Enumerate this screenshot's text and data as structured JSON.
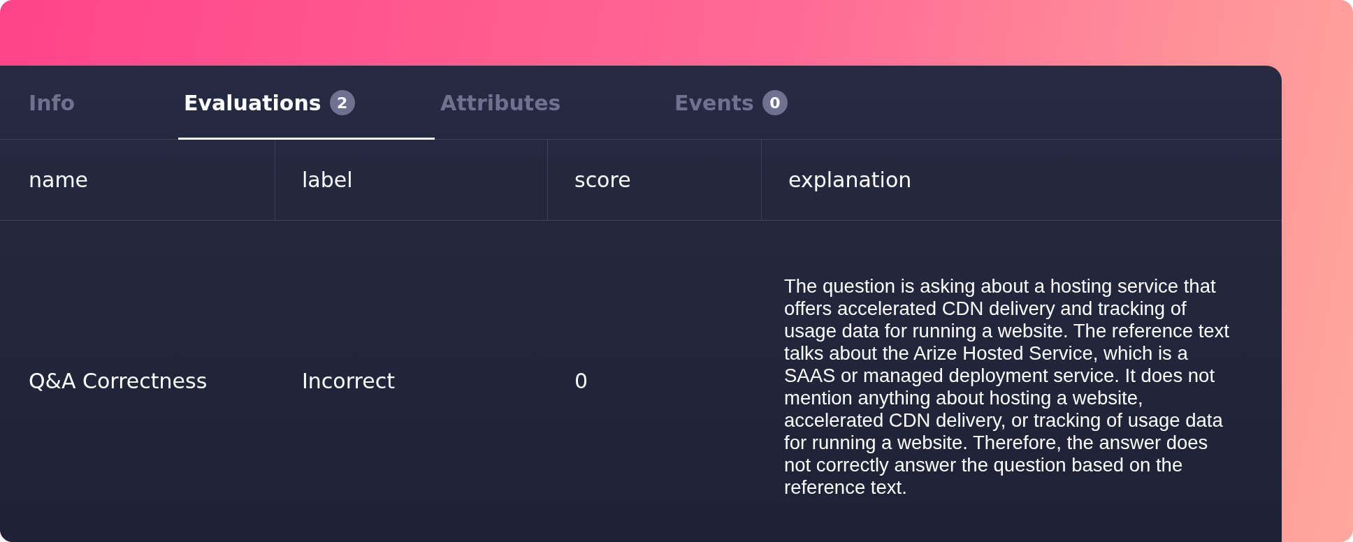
{
  "tabs": [
    {
      "label": "Info",
      "selected": false
    },
    {
      "label": "Evaluations",
      "count": "2",
      "selected": true
    },
    {
      "label": "Attributes",
      "selected": false
    },
    {
      "label": "Events",
      "count": "0",
      "selected": false
    }
  ],
  "table": {
    "columns": [
      "name",
      "label",
      "score",
      "explanation"
    ],
    "rows": [
      {
        "name": "Q&A Correctness",
        "label": "Incorrect",
        "score": "0",
        "explanation": "The question is asking about a hosting service that offers accelerated CDN delivery and tracking of usage data for running a website. The reference text talks about the Arize Hosted Service, which is a SAAS or managed deployment service. It does not mention anything about hosting a website, accelerated CDN delivery, or tracking of usage data for running a website. Therefore, the answer does not correctly answer the question based on the reference text."
      }
    ]
  }
}
